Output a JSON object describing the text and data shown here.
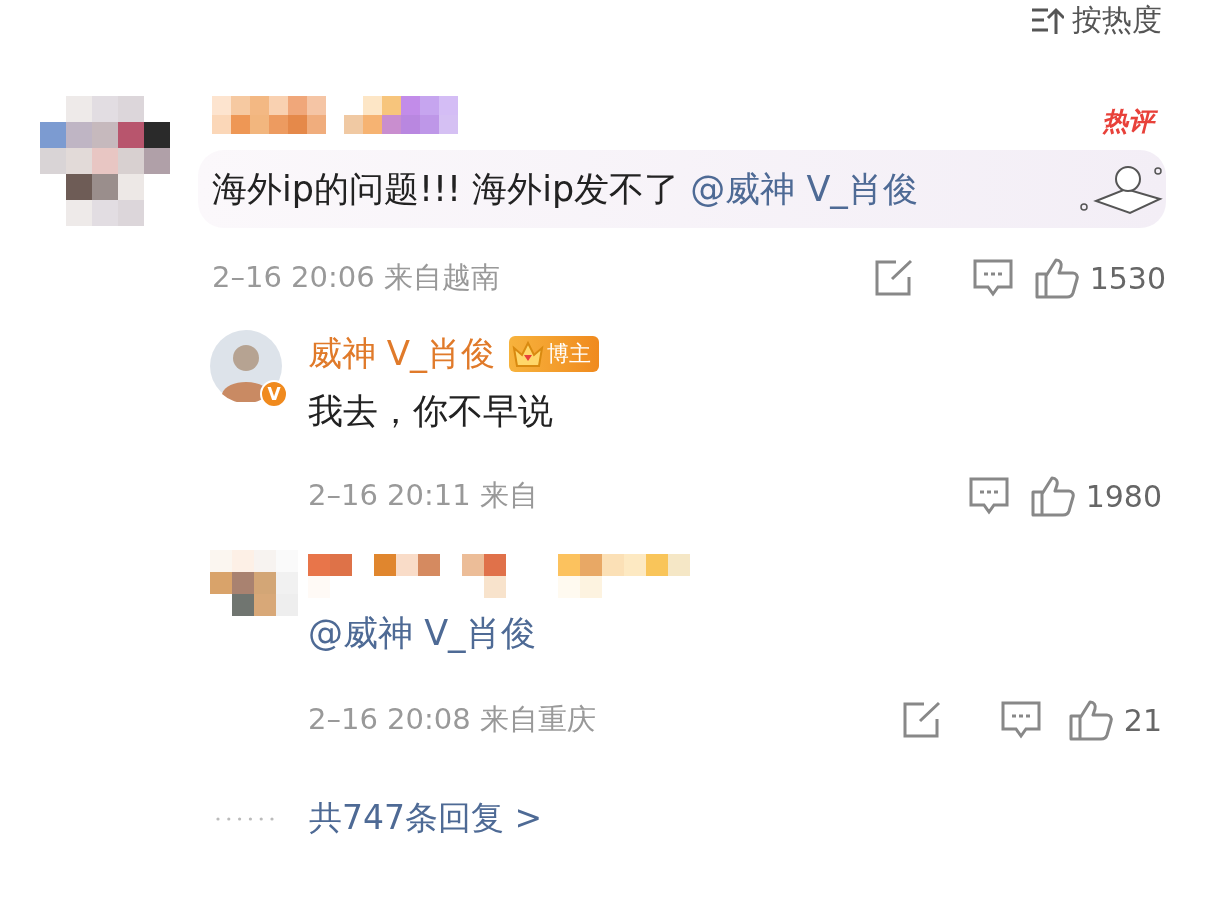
{
  "sort": {
    "label": "按热度"
  },
  "comment": {
    "hot_badge": "热评",
    "text": "海外ip的问题!!! 海外ip发不了",
    "mention": "@威神 V_肖俊",
    "meta": "2–16 20:06 来自越南",
    "actions": [
      {
        "kind": "share"
      },
      {
        "kind": "reply"
      },
      {
        "kind": "like",
        "count": "1530"
      }
    ]
  },
  "replies": [
    {
      "author": "威神 V_肖俊",
      "verified_mark": "V",
      "role_badge": "博主",
      "text": "我去，你不早说",
      "meta": "2–16 20:11 来自",
      "actions": [
        {
          "kind": "reply"
        },
        {
          "kind": "like",
          "count": "1980"
        }
      ]
    },
    {
      "text": "@威神 V_肖俊",
      "meta": "2–16 20:08 来自重庆",
      "actions": [
        {
          "kind": "share"
        },
        {
          "kind": "reply"
        },
        {
          "kind": "like",
          "count": "21"
        }
      ]
    }
  ],
  "more_replies": "共747条回复 >"
}
